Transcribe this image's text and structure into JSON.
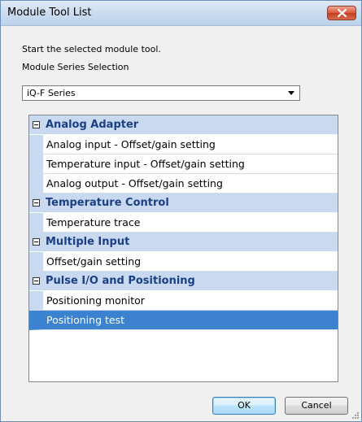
{
  "window": {
    "title": "Module Tool List",
    "close_icon": "close-icon"
  },
  "intro_text": "Start the selected module tool.",
  "series_label": "Module Series Selection",
  "series_select": {
    "value": "iQ-F Series"
  },
  "tool_list": {
    "categories": [
      {
        "label": "Analog Adapter",
        "items": [
          {
            "label": "Analog input - Offset/gain setting"
          },
          {
            "label": "Temperature input - Offset/gain setting"
          },
          {
            "label": "Analog output - Offset/gain setting"
          }
        ]
      },
      {
        "label": "Temperature Control",
        "items": [
          {
            "label": "Temperature trace"
          }
        ]
      },
      {
        "label": "Multiple Input",
        "items": [
          {
            "label": "Offset/gain setting"
          }
        ]
      },
      {
        "label": "Pulse I/O and Positioning",
        "items": [
          {
            "label": "Positioning monitor"
          },
          {
            "label": "Positioning test"
          }
        ]
      }
    ],
    "selected_item": "Positioning test"
  },
  "buttons": {
    "ok": "OK",
    "cancel": "Cancel"
  },
  "colors": {
    "category_bg": "#c9daf0",
    "category_text": "#1b3f86",
    "selection_bg": "#3b82d0"
  }
}
